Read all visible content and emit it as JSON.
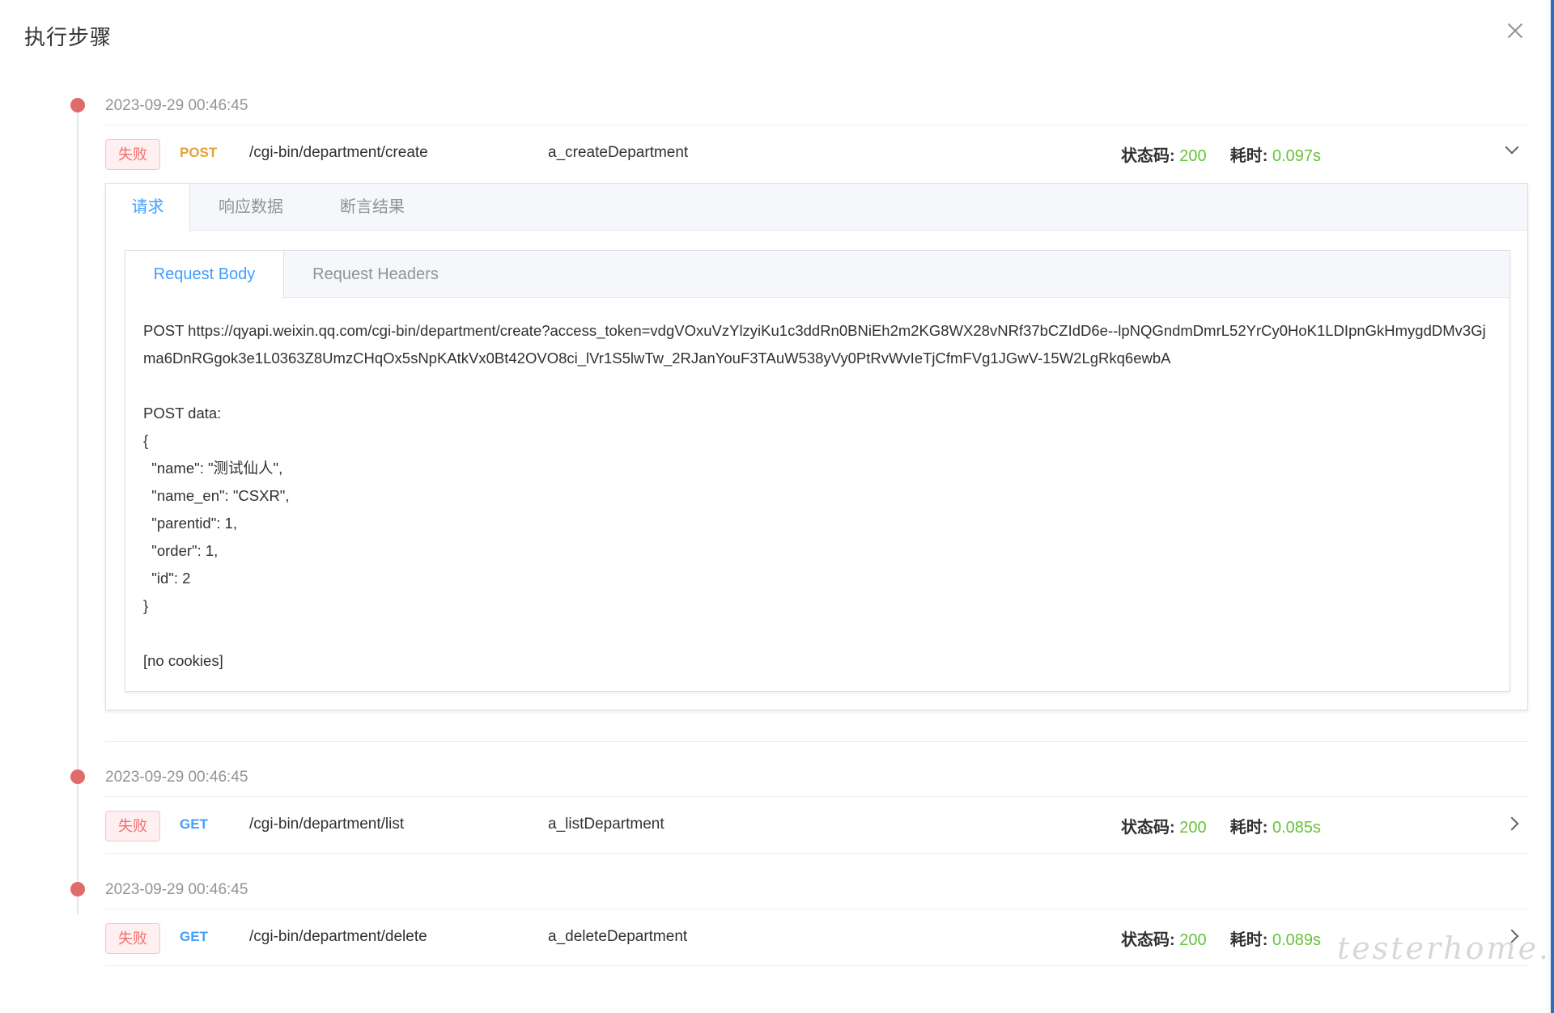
{
  "dialog": {
    "title": "执行步骤"
  },
  "steps": [
    {
      "timestamp": "2023-09-29 00:46:45",
      "status": "失败",
      "method": "POST",
      "path": "/cgi-bin/department/create",
      "name": "a_createDepartment",
      "status_code_label": "状态码:",
      "status_code": "200",
      "time_label": "耗时:",
      "time": "0.097s"
    },
    {
      "timestamp": "2023-09-29 00:46:45",
      "status": "失败",
      "method": "GET",
      "path": "/cgi-bin/department/list",
      "name": "a_listDepartment",
      "status_code_label": "状态码:",
      "status_code": "200",
      "time_label": "耗时:",
      "time": "0.085s"
    },
    {
      "timestamp": "2023-09-29 00:46:45",
      "status": "失败",
      "method": "GET",
      "path": "/cgi-bin/department/delete",
      "name": "a_deleteDepartment",
      "status_code_label": "状态码:",
      "status_code": "200",
      "time_label": "耗时:",
      "time": "0.089s"
    }
  ],
  "detail": {
    "tabs": [
      "请求",
      "响应数据",
      "断言结果"
    ],
    "active_tab": "请求",
    "inner_tabs": [
      "Request Body",
      "Request Headers"
    ],
    "active_inner_tab": "Request Body",
    "body": "POST https://qyapi.weixin.qq.com/cgi-bin/department/create?access_token=vdgVOxuVzYlzyiKu1c3ddRn0BNiEh2m2KG8WX28vNRf37bCZIdD6e--lpNQGndmDmrL52YrCy0HoK1LDIpnGkHmygdDMv3Gjma6DnRGgok3e1L0363Z8UmzCHqOx5sNpKAtkVx0Bt42OVO8ci_lVr1S5lwTw_2RJanYouF3TAuW538yVy0PtRvWvIeTjCfmFVg1JGwV-15W2LgRkq6ewbA\n\nPOST data:\n{\n  \"name\": \"测试仙人\",\n  \"name_en\": \"CSXR\",\n  \"parentid\": 1,\n  \"order\": 1,\n  \"id\": 2\n}\n\n[no cookies]"
  },
  "watermark": "testerhome.com",
  "colors": {
    "accent": "#409eff",
    "success": "#67c23a",
    "danger": "#f56c6c",
    "post": "#e6a23c",
    "dot": "#e06b6b"
  },
  "icons": {
    "close": "close-icon",
    "expanded": "chevron-down-icon",
    "collapsed": "chevron-right-icon"
  }
}
